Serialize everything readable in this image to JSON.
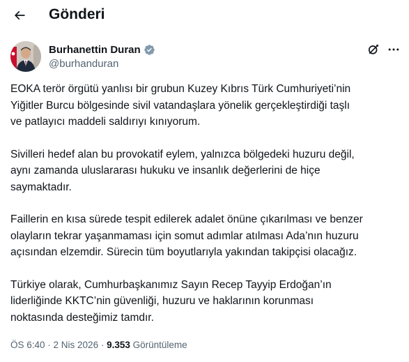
{
  "header": {
    "title": "Gönderi",
    "back_icon": "arrow-left-icon"
  },
  "author": {
    "name": "Burhanettin Duran",
    "handle": "@burhanduran",
    "verified_icon": "verified-badge-icon",
    "badge_color": "#829aab"
  },
  "actions": {
    "grok_icon": "grok-icon",
    "more_icon": "more-horizontal-icon"
  },
  "tweet": {
    "paragraphs": [
      "EOKA terör örgütü yanlısı bir grubun Kuzey Kıbrıs Türk Cumhuriyeti’nin\nYiğitler Burcu bölgesinde sivil vatandaşlara yönelik gerçekleştirdiği taşlı\nve patlayıcı maddeli saldırıyı kınıyorum.",
      "Sivilleri hedef alan bu provokatif eylem, yalnızca bölgedeki huzuru değil,\naynı zamanda uluslararası hukuku ve insanlık değerlerini de hiçe\nsaymaktadır.",
      "Faillerin en kısa sürede tespit edilerek adalet önüne çıkarılması ve benzer\nolayların tekrar yaşanmaması için somut adımlar atılması Ada’nın huzuru\naçısından elzemdir. Sürecin tüm boyutlarıyla yakından takipçisi olacağız.",
      "Türkiye olarak, Cumhurbaşkanımız Sayın Recep Tayyip Erdoğan’ın\nliderliğinde KKTC’nin güvenliği, huzuru ve haklarının korunması\nnoktasında desteğimiz tamdır."
    ]
  },
  "meta": {
    "time": "ÖS 6:40",
    "separator": " · ",
    "date": "2 Nis 2026",
    "views_count": "9.353",
    "views_label": "Görüntüleme"
  }
}
